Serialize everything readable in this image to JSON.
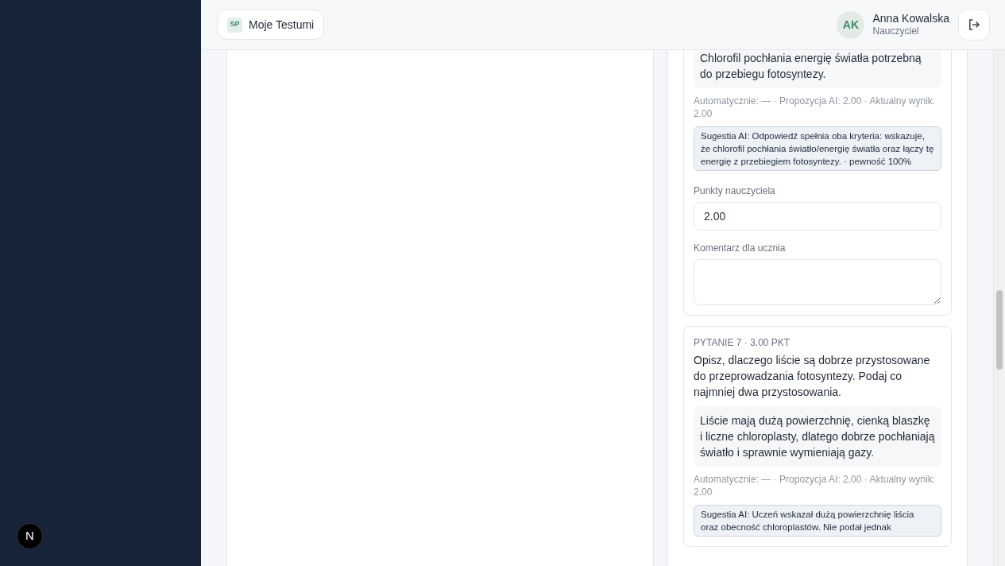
{
  "header": {
    "app_badge": "SP",
    "app_title": "Moje Testumi",
    "user": {
      "initials": "AK",
      "name": "Anna Kowalska",
      "role": "Nauczyciel"
    }
  },
  "questions": [
    {
      "answer": "Chlorofil pochłania energię światła potrzebną do przebiegu fotosyntezy.",
      "scores": "Automatycznie: — · Propozycja AI: 2.00 · Aktualny wynik: 2.00",
      "ai_suggestion": "Sugestia AI: Odpowiedź spełnia oba kryteria: wskazuje, że chlorofil pochłania światło/energię światła oraz łączy tę energię z przebiegiem fotosyntezy. · pewność 100%",
      "points_label": "Punkty nauczyciela",
      "points_value": "2.00",
      "comment_label": "Komentarz dla ucznia"
    },
    {
      "heading": "PYTANIE 7 · 3.00 PKT",
      "prompt": "Opisz, dlaczego liście są dobrze przystosowane do przeprowadzania fotosyntezy. Podaj co najmniej dwa przystosowania.",
      "answer": "Liście mają dużą powierzchnię, cienką blaszkę i liczne chloroplasty, dlatego dobrze pochłaniają światło i sprawnie wymieniają gazy.",
      "scores": "Automatycznie: — · Propozycja AI: 2.00 · Aktualny wynik: 2.00",
      "ai_suggestion": "Sugestia AI: Uczeń wskazał dużą powierzchnię liścia oraz obecność chloroplastów. Nie podał jednak"
    }
  ],
  "dev_badge": "N"
}
